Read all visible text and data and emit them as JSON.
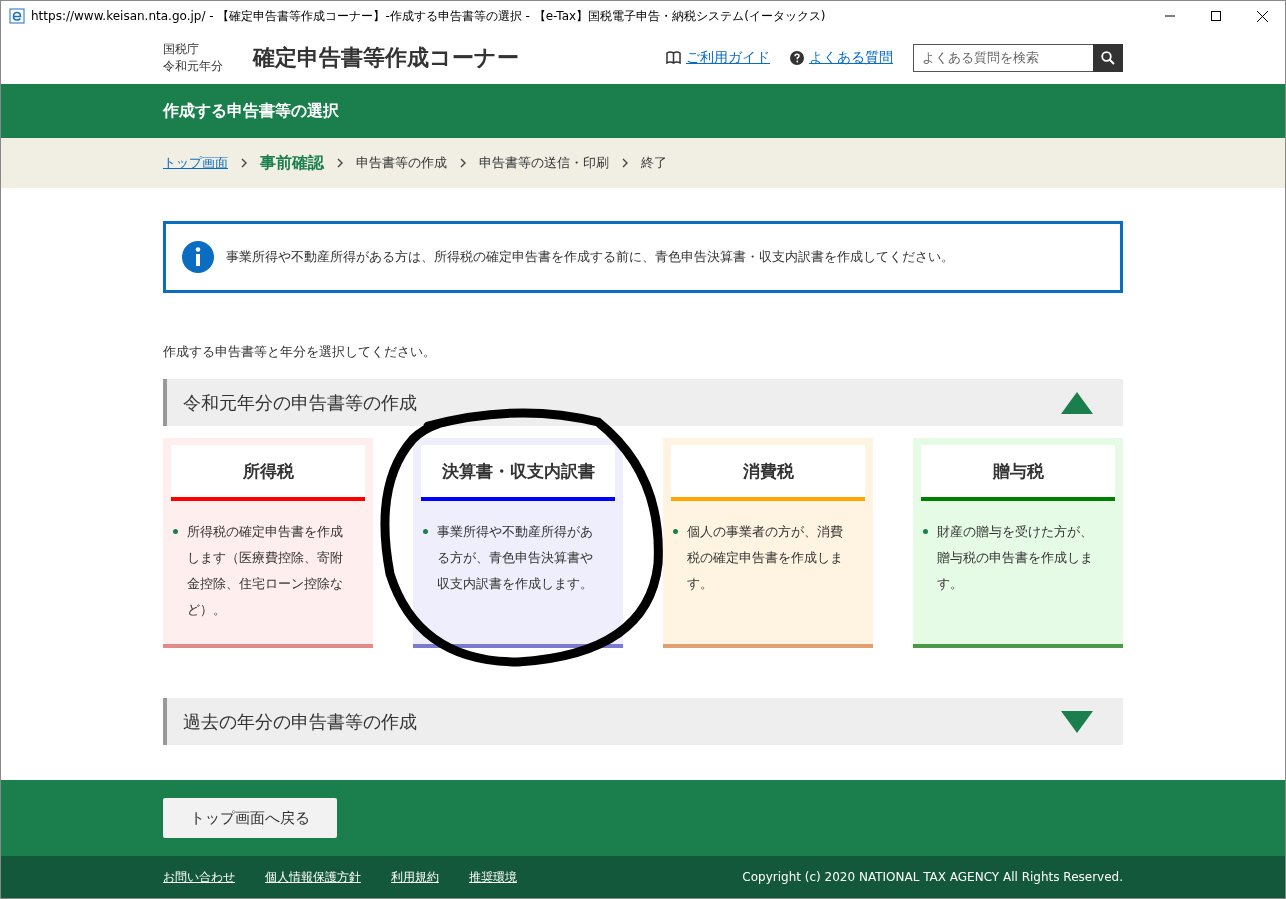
{
  "window": {
    "title": "https://www.keisan.nta.go.jp/ - 【確定申告書等作成コーナー】-作成する申告書等の選択 - 【e-Tax】国税電子申告・納税システム(イータックス)"
  },
  "header": {
    "agency": "国税庁",
    "year": "令和元年分",
    "site_title": "確定申告書等作成コーナー",
    "links": [
      "ご利用ガイド",
      "よくある質問"
    ],
    "search": {
      "placeholder": "よくある質問を検索"
    }
  },
  "page_title": "作成する申告書等の選択",
  "breadcrumb": [
    {
      "label": "トップ画面",
      "kind": "link"
    },
    {
      "label": "事前確認",
      "kind": "current"
    },
    {
      "label": "申告書等の作成",
      "kind": "step"
    },
    {
      "label": "申告書等の送信・印刷",
      "kind": "step"
    },
    {
      "label": "終了",
      "kind": "step"
    }
  ],
  "info": "事業所得や不動産所得がある方は、所得税の確定申告書を作成する前に、青色申告決算書・収支内訳書を作成してください。",
  "prompt": "作成する申告書等と年分を選択してください。",
  "sections": [
    {
      "title": "令和元年分の申告書等の作成",
      "expanded": true,
      "cards": [
        {
          "title": "所得税",
          "color": "#ff0000",
          "text": "所得税の確定申告書を作成します（医療費控除、寄附金控除、住宅ローン控除など）。",
          "circled": false
        },
        {
          "title": "決算書・収支内訳書",
          "color": "#0000ff",
          "text": "事業所得や不動産所得がある方が、青色申告決算書や収支内訳書を作成します。",
          "circled": true
        },
        {
          "title": "消費税",
          "color": "#ffa500",
          "text": "個人の事業者の方が、消費税の確定申告書を作成します。",
          "circled": false
        },
        {
          "title": "贈与税",
          "color": "#008000",
          "text": "財産の贈与を受けた方が、贈与税の申告書を作成します。",
          "circled": false
        }
      ]
    },
    {
      "title": "過去の年分の申告書等の作成",
      "expanded": false
    }
  ],
  "back_button": "トップ画面へ戻る",
  "footer": {
    "links": [
      "お問い合わせ",
      "個人情報保護方針",
      "利用規約",
      "推奨環境"
    ],
    "copyright": "Copyright (c) 2020 NATIONAL TAX AGENCY All Rights Reserved."
  }
}
